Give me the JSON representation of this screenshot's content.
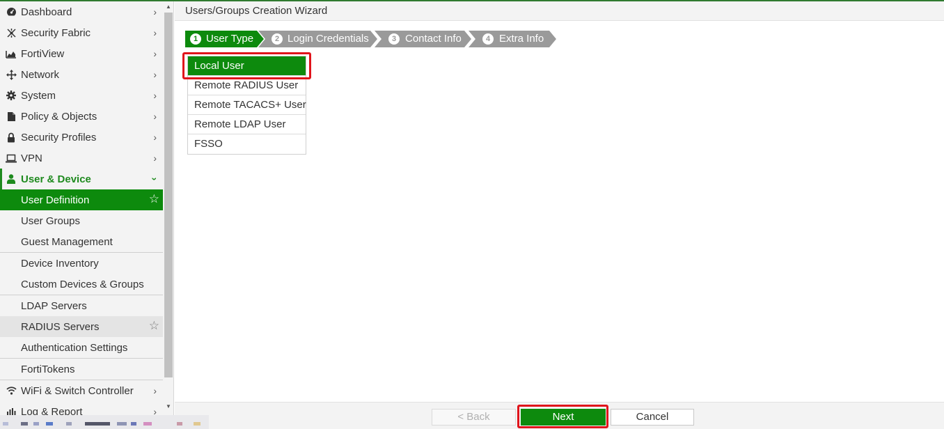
{
  "sidebar": {
    "items": [
      {
        "label": "Dashboard",
        "icon": "dashboard-icon"
      },
      {
        "label": "Security Fabric",
        "icon": "security-fabric-icon"
      },
      {
        "label": "FortiView",
        "icon": "fortiview-icon"
      },
      {
        "label": "Network",
        "icon": "network-icon"
      },
      {
        "label": "System",
        "icon": "gear-icon"
      },
      {
        "label": "Policy & Objects",
        "icon": "policy-icon"
      },
      {
        "label": "Security Profiles",
        "icon": "lock-icon"
      },
      {
        "label": "VPN",
        "icon": "laptop-icon"
      },
      {
        "label": "User & Device",
        "icon": "user-icon"
      }
    ],
    "user_device_sub": [
      {
        "label": "User Definition",
        "selected": true,
        "starred_icon": "star-outline-icon"
      },
      {
        "label": "User Groups"
      },
      {
        "label": "Guest Management"
      },
      {
        "label": "Device Inventory"
      },
      {
        "label": "Custom Devices & Groups"
      },
      {
        "label": "LDAP Servers"
      },
      {
        "label": "RADIUS Servers",
        "hover": true,
        "starred_icon": "star-outline-icon"
      },
      {
        "label": "Authentication Settings"
      },
      {
        "label": "FortiTokens"
      }
    ],
    "bottom_items": [
      {
        "label": "WiFi & Switch Controller",
        "icon": "wifi-icon"
      },
      {
        "label": "Log & Report",
        "icon": "chart-icon"
      }
    ]
  },
  "wizard": {
    "title": "Users/Groups Creation Wizard",
    "steps": [
      {
        "num": "1",
        "label": "User Type",
        "active": true
      },
      {
        "num": "2",
        "label": "Login Credentials",
        "active": false
      },
      {
        "num": "3",
        "label": "Contact Info",
        "active": false
      },
      {
        "num": "4",
        "label": "Extra Info",
        "active": false
      }
    ],
    "user_types": [
      "Local User",
      "Remote RADIUS User",
      "Remote TACACS+ User",
      "Remote LDAP User",
      "FSSO"
    ],
    "selected_user_type": "Local User"
  },
  "footer": {
    "back_label": "< Back",
    "next_label": "Next",
    "cancel_label": "Cancel"
  },
  "colors": {
    "accent_green": "#0d8a0d",
    "step_inactive": "#9a9a9a",
    "highlight_red": "#e0141b"
  }
}
